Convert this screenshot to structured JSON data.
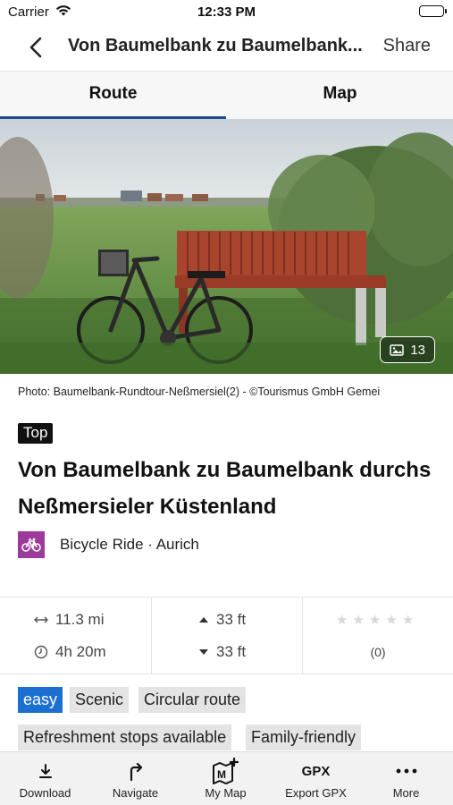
{
  "status_bar": {
    "carrier": "Carrier",
    "time": "12:33 PM"
  },
  "nav": {
    "title": "Von Baumelbank zu Baumelbank...",
    "share_label": "Share"
  },
  "tabs": [
    {
      "label": "Route",
      "active": true
    },
    {
      "label": "Map",
      "active": false
    }
  ],
  "hero": {
    "photo_count": "13"
  },
  "caption": "Photo: Baumelbank-Rundtour-Neßmersiel(2) - ©Tourismus GmbH Gemei",
  "badge": "Top",
  "heading": "Von Baumelbank zu Baumelbank durchs Neßmersieler Küstenland",
  "category": {
    "text": "Bicycle Ride · Aurich",
    "icon": "bicycle-icon",
    "color": "#9b3a9b"
  },
  "stats": {
    "distance": "11.3 mi",
    "duration": "4h 20m",
    "ascent": "33 ft",
    "descent": "33 ft",
    "rating_count": "(0)",
    "stars": 5
  },
  "tags": [
    {
      "label": "easy",
      "highlight": true
    },
    {
      "label": "Scenic",
      "highlight": false
    },
    {
      "label": "Circular route",
      "highlight": false
    },
    {
      "label": "Refreshment stops available",
      "highlight": false
    },
    {
      "label": "Family-friendly",
      "highlight": false
    }
  ],
  "toolbar": [
    {
      "label": "Download",
      "icon": "download-icon"
    },
    {
      "label": "Navigate",
      "icon": "navigate-icon"
    },
    {
      "label": "My Map",
      "icon": "my-map-icon"
    },
    {
      "label": "Export GPX",
      "icon": "gpx-icon",
      "icon_text": "GPX"
    },
    {
      "label": "More",
      "icon": "more-icon"
    }
  ],
  "colors": {
    "accent": "#1e4f8a",
    "easy": "#1a6fd1",
    "category": "#9b3a9b"
  }
}
